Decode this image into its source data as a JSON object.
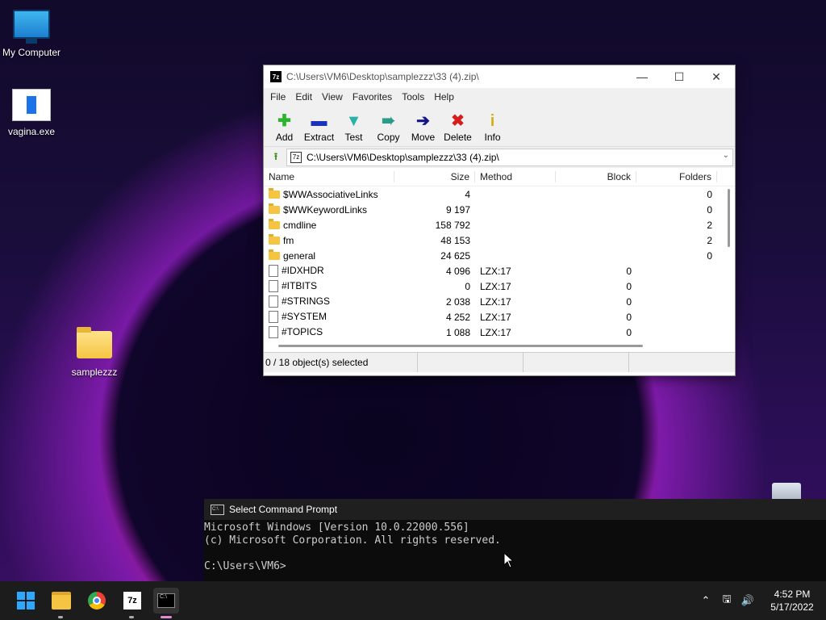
{
  "desktop": {
    "icons": [
      {
        "label": "My Computer"
      },
      {
        "label": "vagina.exe"
      },
      {
        "label": "samplezzz"
      }
    ]
  },
  "sevenzip": {
    "title": "C:\\Users\\VM6\\Desktop\\samplezzz\\33 (4).zip\\",
    "menu": [
      "File",
      "Edit",
      "View",
      "Favorites",
      "Tools",
      "Help"
    ],
    "toolbar": [
      {
        "label": "Add",
        "icon": "plus-icon",
        "color": "#2db52d"
      },
      {
        "label": "Extract",
        "icon": "minus-icon",
        "color": "#1a33b8"
      },
      {
        "label": "Test",
        "icon": "check-icon",
        "color": "#29b3a8"
      },
      {
        "label": "Copy",
        "icon": "double-arrow-icon",
        "color": "#2a9a8a"
      },
      {
        "label": "Move",
        "icon": "arrow-right-icon",
        "color": "#14148a"
      },
      {
        "label": "Delete",
        "icon": "x-icon",
        "color": "#d81b1b"
      },
      {
        "label": "Info",
        "icon": "info-icon",
        "color": "#d1b01a"
      }
    ],
    "address": "C:\\Users\\VM6\\Desktop\\samplezzz\\33 (4).zip\\",
    "columns": [
      "Name",
      "Size",
      "Method",
      "Block",
      "Folders"
    ],
    "rows": [
      {
        "type": "folder",
        "name": "$WWAssociativeLinks",
        "size": "4",
        "method": "",
        "block": "",
        "folders": "0"
      },
      {
        "type": "folder",
        "name": "$WWKeywordLinks",
        "size": "9 197",
        "method": "",
        "block": "",
        "folders": "0"
      },
      {
        "type": "folder",
        "name": "cmdline",
        "size": "158 792",
        "method": "",
        "block": "",
        "folders": "2"
      },
      {
        "type": "folder",
        "name": "fm",
        "size": "48 153",
        "method": "",
        "block": "",
        "folders": "2"
      },
      {
        "type": "folder",
        "name": "general",
        "size": "24 625",
        "method": "",
        "block": "",
        "folders": "0"
      },
      {
        "type": "file",
        "name": "#IDXHDR",
        "size": "4 096",
        "method": "LZX:17",
        "block": "0",
        "folders": ""
      },
      {
        "type": "file",
        "name": "#ITBITS",
        "size": "0",
        "method": "LZX:17",
        "block": "0",
        "folders": ""
      },
      {
        "type": "file",
        "name": "#STRINGS",
        "size": "2 038",
        "method": "LZX:17",
        "block": "0",
        "folders": ""
      },
      {
        "type": "file",
        "name": "#SYSTEM",
        "size": "4 252",
        "method": "LZX:17",
        "block": "0",
        "folders": ""
      },
      {
        "type": "file",
        "name": "#TOPICS",
        "size": "1 088",
        "method": "LZX:17",
        "block": "0",
        "folders": ""
      }
    ],
    "status": "0 / 18 object(s) selected"
  },
  "cmd": {
    "title": "Select Command Prompt",
    "lines": [
      "Microsoft Windows [Version 10.0.22000.556]",
      "(c) Microsoft Corporation. All rights reserved.",
      "",
      "C:\\Users\\VM6>"
    ]
  },
  "taskbar": {
    "apps": [
      "start-icon",
      "file-explorer-icon",
      "chrome-icon",
      "7zip-icon",
      "terminal-icon"
    ],
    "time": "4:52 PM",
    "date": "5/17/2022"
  }
}
